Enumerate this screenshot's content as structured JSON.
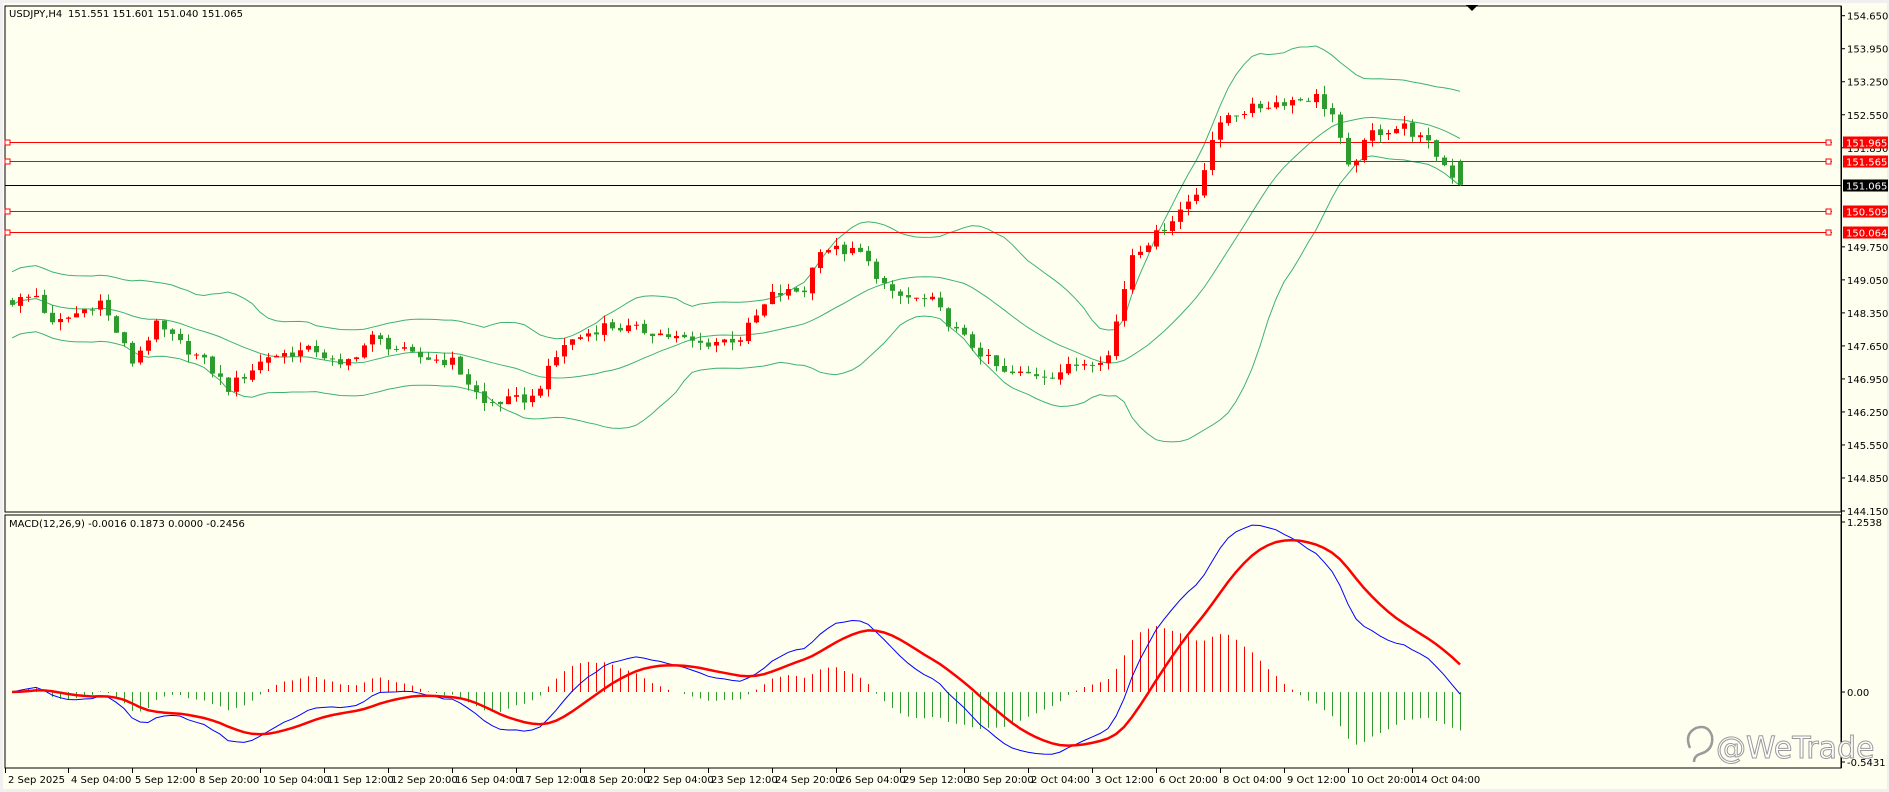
{
  "header": {
    "symbol_timeframe": "USDJPY,H4",
    "ohlc_text": "151.551 151.601 151.040 151.065"
  },
  "macd_header": {
    "text": "MACD(12,26,9) -0.0016 0.1873 0.0000 -0.2456"
  },
  "watermark": "@WeTrade",
  "colors": {
    "background": "#fffff0",
    "bull_candle": "#ff0000",
    "bear_candle": "#2e9b2e",
    "bollinger": "#3cb371",
    "macd_line": "#0000ff",
    "signal_line": "#ff0000",
    "hist_positive": "#ff0000",
    "hist_negative": "#2e9b2e",
    "level_line": "#ff0000",
    "current_price_line": "#000000"
  },
  "chart_data": [
    {
      "type": "candlestick",
      "symbol": "USDJPY",
      "timeframe": "H4",
      "ylim": [
        144.15,
        154.65
      ],
      "y_ticks": [
        "154.650",
        "153.950",
        "153.250",
        "152.550",
        "151.850",
        "149.750",
        "149.050",
        "148.350",
        "147.650",
        "146.950",
        "146.250",
        "145.550",
        "144.850",
        "144.150"
      ],
      "x_ticks": [
        {
          "label": "2 Sep 2025",
          "bar": 0
        },
        {
          "label": "4 Sep 04:00",
          "bar": 7
        },
        {
          "label": "5 Sep 12:00",
          "bar": 15
        },
        {
          "label": "8 Sep 20:00",
          "bar": 23
        },
        {
          "label": "10 Sep 04:00",
          "bar": 31
        },
        {
          "label": "11 Sep 12:00",
          "bar": 39
        },
        {
          "label": "12 Sep 20:00",
          "bar": 47
        },
        {
          "label": "16 Sep 04:00",
          "bar": 55
        },
        {
          "label": "17 Sep 12:00",
          "bar": 63
        },
        {
          "label": "18 Sep 20:00",
          "bar": 71
        },
        {
          "label": "22 Sep 04:00",
          "bar": 79
        },
        {
          "label": "23 Sep 12:00",
          "bar": 87
        },
        {
          "label": "24 Sep 20:00",
          "bar": 95
        },
        {
          "label": "26 Sep 04:00",
          "bar": 103
        },
        {
          "label": "29 Sep 12:00",
          "bar": 111
        },
        {
          "label": "30 Sep 20:00",
          "bar": 119
        },
        {
          "label": "2 Oct 04:00",
          "bar": 127
        },
        {
          "label": "3 Oct 12:00",
          "bar": 135
        },
        {
          "label": "6 Oct 20:00",
          "bar": 143
        },
        {
          "label": "8 Oct 04:00",
          "bar": 151
        },
        {
          "label": "9 Oct 12:00",
          "bar": 159
        },
        {
          "label": "10 Oct 20:00",
          "bar": 167
        },
        {
          "label": "14 Oct 04:00",
          "bar": 175
        }
      ],
      "bar_count": 182,
      "close_keypoints": [
        [
          0,
          148.59
        ],
        [
          3,
          148.72
        ],
        [
          5,
          148.08
        ],
        [
          11,
          148.59
        ],
        [
          15,
          147.31
        ],
        [
          18,
          148.08
        ],
        [
          24,
          147.31
        ],
        [
          27,
          146.75
        ],
        [
          32,
          147.44
        ],
        [
          38,
          147.57
        ],
        [
          41,
          147.18
        ],
        [
          45,
          147.82
        ],
        [
          50,
          147.44
        ],
        [
          55,
          147.31
        ],
        [
          59,
          146.42
        ],
        [
          65,
          146.55
        ],
        [
          69,
          147.69
        ],
        [
          74,
          148.08
        ],
        [
          80,
          147.95
        ],
        [
          86,
          147.69
        ],
        [
          91,
          147.82
        ],
        [
          95,
          148.72
        ],
        [
          99,
          148.84
        ],
        [
          101,
          149.74
        ],
        [
          106,
          149.61
        ],
        [
          110,
          148.72
        ],
        [
          115,
          148.59
        ],
        [
          118,
          147.95
        ],
        [
          124,
          147.05
        ],
        [
          130,
          147.05
        ],
        [
          134,
          147.31
        ],
        [
          137,
          147.44
        ],
        [
          140,
          149.61
        ],
        [
          143,
          150.0
        ],
        [
          148,
          150.89
        ],
        [
          150,
          152.04
        ],
        [
          152,
          152.55
        ],
        [
          158,
          152.81
        ],
        [
          163,
          152.93
        ],
        [
          165,
          152.55
        ],
        [
          167,
          151.4
        ],
        [
          170,
          152.17
        ],
        [
          174,
          152.3
        ],
        [
          177,
          151.91
        ],
        [
          181,
          151.065
        ]
      ],
      "last_bar": {
        "open": 151.551,
        "high": 151.601,
        "low": 151.04,
        "close": 151.065
      },
      "indicators": {
        "bollinger": {
          "period": 20,
          "deviation": 2
        }
      },
      "horizontal_levels": [
        {
          "price": 151.965,
          "label": "151.965"
        },
        {
          "price": 151.565,
          "label": "151.565"
        },
        {
          "price": 150.509,
          "label": "150.509"
        },
        {
          "price": 150.064,
          "label": "150.064"
        }
      ],
      "current_price": {
        "price": 151.065,
        "label": "151.065"
      }
    },
    {
      "type": "macd",
      "params": [
        12,
        26,
        9
      ],
      "values": {
        "macd": -0.0016,
        "signal": 0.1873,
        "zero": 0.0,
        "histogram": -0.2456
      },
      "ylim": [
        -0.5431,
        1.2538
      ],
      "y_ticks": [
        "1.2538",
        "0.00",
        "-0.5431"
      ]
    }
  ]
}
